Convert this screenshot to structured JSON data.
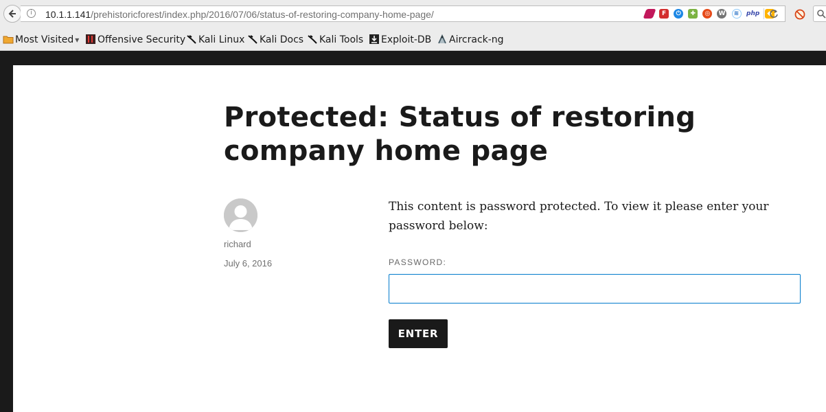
{
  "browser": {
    "url_host": "10.1.1.141",
    "url_path": "/prehistoricforest/index.php/2016/07/06/status-of-restoring-company-home-page/",
    "extension_icons": [
      "hackbar-icon",
      "firebug-icon",
      "power-icon",
      "puzzle-icon",
      "ubuntu-icon",
      "wordpress-icon",
      "wifi-icon",
      "php-icon",
      "cube-icon"
    ],
    "bookmarks": [
      {
        "label": "Most Visited",
        "icon": "folder-icon",
        "dropdown": "▾"
      },
      {
        "label": "Offensive Security",
        "icon": "offsec-icon"
      },
      {
        "label": "Kali Linux",
        "icon": "kali-dragon-icon"
      },
      {
        "label": "Kali Docs",
        "icon": "kali-dragon-icon"
      },
      {
        "label": "Kali Tools",
        "icon": "kali-dragon-icon"
      },
      {
        "label": "Exploit-DB",
        "icon": "exploitdb-icon"
      },
      {
        "label": "Aircrack-ng",
        "icon": "aircrack-icon"
      }
    ]
  },
  "post": {
    "title": "Protected: Status of restoring company home page",
    "author": "richard",
    "date": "July 6, 2016",
    "notice": "This content is password protected. To view it please enter your password below:",
    "password_label": "PASSWORD:",
    "password_value": "",
    "submit_label": "ENTER"
  },
  "colors": {
    "accent": "#007acc",
    "text": "#1a1a1a",
    "meta": "#707070",
    "frame": "#1a1a1a"
  }
}
